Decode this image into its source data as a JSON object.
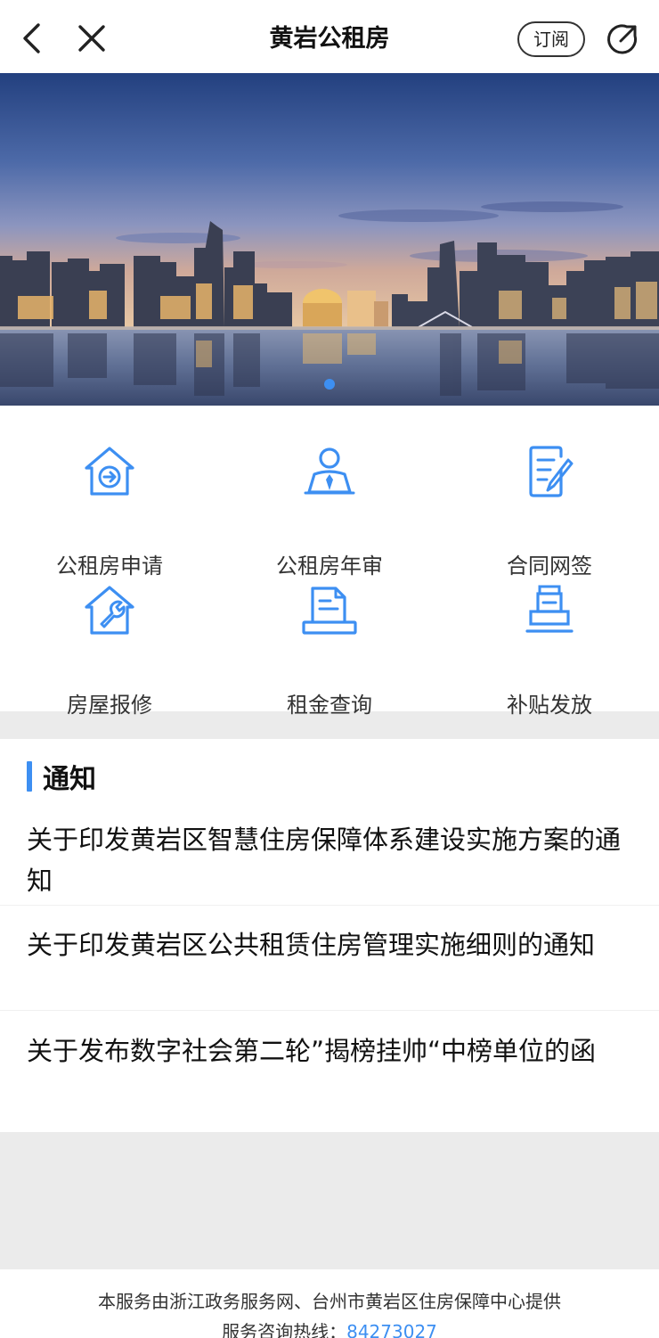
{
  "navbar": {
    "title": "黄岩公租房",
    "subscribe_label": "订阅",
    "back_icon": "chevron-left-icon",
    "close_icon": "close-icon",
    "share_icon": "share-icon"
  },
  "banner": {
    "image": "city-skyline-at-dusk",
    "page_indicator_active": 1,
    "page_indicator_total": 1
  },
  "services": [
    {
      "label": "公租房申请",
      "icon": "house-arrow-icon"
    },
    {
      "label": "公租房年审",
      "icon": "person-tie-icon"
    },
    {
      "label": "合同网签",
      "icon": "document-pen-icon"
    },
    {
      "label": "房屋报修",
      "icon": "house-wrench-icon"
    },
    {
      "label": "租金查询",
      "icon": "receipt-icon"
    },
    {
      "label": "补贴发放",
      "icon": "stamp-icon"
    }
  ],
  "notice": {
    "title": "通知",
    "items": [
      {
        "text": "关于印发黄岩区智慧住房保障体系建设实施方案的通知"
      },
      {
        "text": "关于印发黄岩区公共租赁住房管理实施细则的通知"
      },
      {
        "text": "关于发布数字社会第二轮”揭榜挂帅“中榜单位的函"
      }
    ]
  },
  "footer": {
    "provider": "本服务由浙江政务服务网、台州市黄岩区住房保障中心提供",
    "hotline_label": "服务咨询热线：",
    "hotline_number": "84273027"
  },
  "colors": {
    "accent": "#3d8ff2",
    "page_bg": "#ebebeb"
  }
}
